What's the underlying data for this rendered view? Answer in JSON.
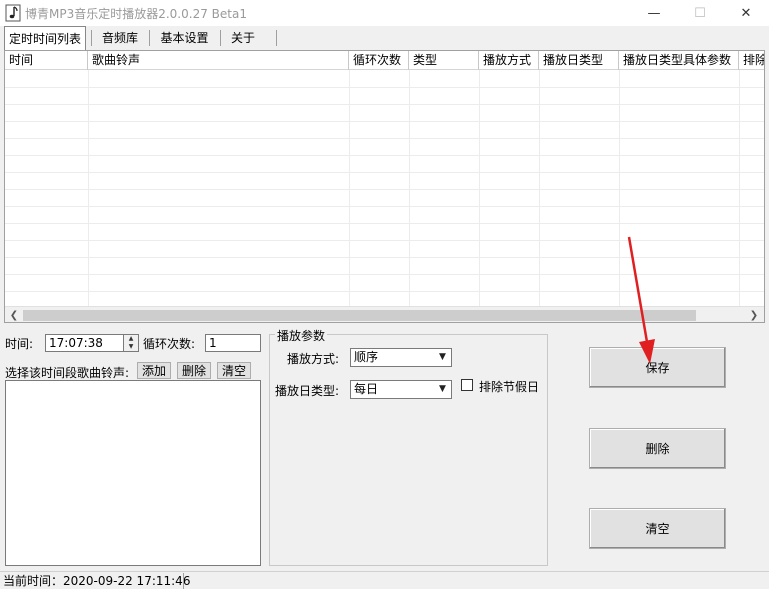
{
  "window": {
    "title": "博青MP3音乐定时播放器2.0.0.27 Beta1",
    "controls": {
      "minimize": "—",
      "maximize": "☐",
      "close": "✕"
    }
  },
  "tabs": [
    {
      "label": "定时时间列表",
      "active": true
    },
    {
      "label": "音频库",
      "active": false
    },
    {
      "label": "基本设置",
      "active": false
    },
    {
      "label": "关于",
      "active": false
    }
  ],
  "table": {
    "columns": [
      "时间",
      "歌曲铃声",
      "循环次数",
      "类型",
      "播放方式",
      "播放日类型",
      "播放日类型具体参数",
      "排除"
    ],
    "rows": []
  },
  "form": {
    "time_label": "时间:",
    "time_value": "17:07:38",
    "loop_label": "循环次数:",
    "loop_value": "1",
    "song_label": "选择该时间段歌曲铃声:",
    "add_label": "添加",
    "delete_label": "删除",
    "clear_label": "清空"
  },
  "play_params": {
    "group_title": "播放参数",
    "mode_label": "播放方式:",
    "mode_value": "顺序",
    "day_type_label": "播放日类型:",
    "day_type_value": "每日",
    "exclude_holidays_label": "排除节假日",
    "exclude_holidays_checked": false
  },
  "actions": {
    "save_label": "保存",
    "delete_label": "删除",
    "clear_label": "清空"
  },
  "status": {
    "current_time": "当前时间：2020-09-22 17:11:46"
  },
  "colors": {
    "annotation_arrow": "#e02020",
    "window_bg": "#f0f0f0"
  }
}
